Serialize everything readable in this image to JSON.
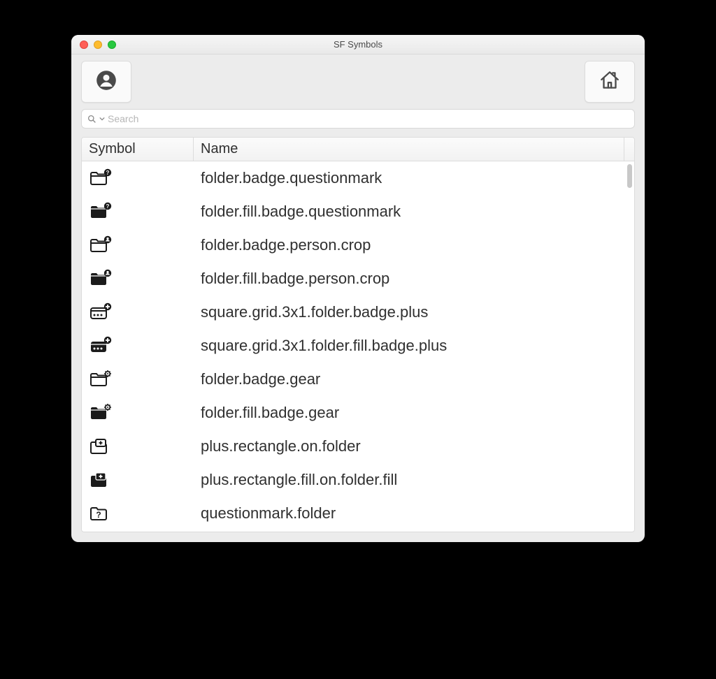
{
  "window": {
    "title": "SF Symbols"
  },
  "toolbar": {
    "profile_name": "person-circle-icon",
    "home_name": "house-icon"
  },
  "search": {
    "placeholder": "Search"
  },
  "table": {
    "headers": {
      "symbol": "Symbol",
      "name": "Name"
    },
    "rows": [
      {
        "icon": "folder-badge-questionmark",
        "name": "folder.badge.questionmark"
      },
      {
        "icon": "folder-fill-badge-questionmark",
        "name": "folder.fill.badge.questionmark"
      },
      {
        "icon": "folder-badge-person",
        "name": "folder.badge.person.crop"
      },
      {
        "icon": "folder-fill-badge-person",
        "name": "folder.fill.badge.person.crop"
      },
      {
        "icon": "square-grid-folder-badge-plus",
        "name": "square.grid.3x1.folder.badge.plus"
      },
      {
        "icon": "square-grid-folder-fill-badge-plus",
        "name": "square.grid.3x1.folder.fill.badge.plus"
      },
      {
        "icon": "folder-badge-gear",
        "name": "folder.badge.gear"
      },
      {
        "icon": "folder-fill-badge-gear",
        "name": "folder.fill.badge.gear"
      },
      {
        "icon": "plus-rectangle-on-folder",
        "name": "plus.rectangle.on.folder"
      },
      {
        "icon": "plus-rectangle-fill-on-folder-fill",
        "name": "plus.rectangle.fill.on.folder.fill"
      },
      {
        "icon": "questionmark-folder",
        "name": "questionmark.folder"
      }
    ]
  }
}
